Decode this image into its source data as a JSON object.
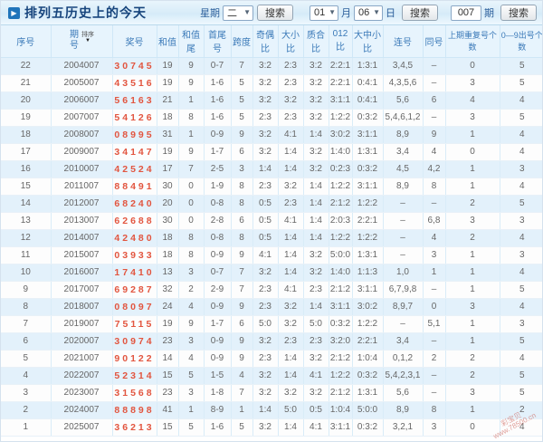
{
  "header": {
    "title": "排列五历史上的今天",
    "weekday_label": "星期",
    "weekday_value": "二",
    "month_value": "01",
    "month_label": "月",
    "day_value": "06",
    "day_label": "日",
    "issue_value": "007",
    "issue_label": "期",
    "search_label": "搜索"
  },
  "table": {
    "columns": [
      {
        "key": "xuhao",
        "label": "序号"
      },
      {
        "key": "qihao",
        "label": "期号",
        "sortable": true,
        "sort_label": "排序",
        "stack": true
      },
      {
        "key": "jianghao",
        "label": "奖号"
      },
      {
        "key": "hezhi",
        "label": "和值"
      },
      {
        "key": "hezhiwei",
        "label": "和值尾"
      },
      {
        "key": "shouweihao",
        "label": "首尾号"
      },
      {
        "key": "kuadu",
        "label": "跨度"
      },
      {
        "key": "jioubi",
        "label": "奇偶比"
      },
      {
        "key": "daxiaobi",
        "label": "大小比"
      },
      {
        "key": "zhihebi",
        "label": "质合比"
      },
      {
        "key": "bi012",
        "label": "012比"
      },
      {
        "key": "dazhongxiaobi",
        "label": "大中小比"
      },
      {
        "key": "lianhao",
        "label": "连号"
      },
      {
        "key": "tonghao",
        "label": "同号"
      },
      {
        "key": "repeat",
        "label": "上期重复号个数",
        "small": true
      },
      {
        "key": "count09",
        "label": "0—9出号个数",
        "small": true
      }
    ],
    "rows": [
      [
        "22",
        "2004007",
        "30745",
        "19",
        "9",
        "0-7",
        "7",
        "3:2",
        "2:3",
        "3:2",
        "2:2:1",
        "1:3:1",
        "3,4,5",
        "–",
        "0",
        "5"
      ],
      [
        "21",
        "2005007",
        "43516",
        "19",
        "9",
        "1-6",
        "5",
        "3:2",
        "2:3",
        "3:2",
        "2:2:1",
        "0:4:1",
        "4,3,5,6",
        "–",
        "3",
        "5"
      ],
      [
        "20",
        "2006007",
        "56163",
        "21",
        "1",
        "1-6",
        "5",
        "3:2",
        "3:2",
        "3:2",
        "3:1:1",
        "0:4:1",
        "5,6",
        "6",
        "4",
        "4"
      ],
      [
        "19",
        "2007007",
        "54126",
        "18",
        "8",
        "1-6",
        "5",
        "2:3",
        "2:3",
        "3:2",
        "1:2:2",
        "0:3:2",
        "5,4,6,1,2",
        "–",
        "3",
        "5"
      ],
      [
        "18",
        "2008007",
        "08995",
        "31",
        "1",
        "0-9",
        "9",
        "3:2",
        "4:1",
        "1:4",
        "3:0:2",
        "3:1:1",
        "8,9",
        "9",
        "1",
        "4"
      ],
      [
        "17",
        "2009007",
        "34147",
        "19",
        "9",
        "1-7",
        "6",
        "3:2",
        "1:4",
        "3:2",
        "1:4:0",
        "1:3:1",
        "3,4",
        "4",
        "0",
        "4"
      ],
      [
        "16",
        "2010007",
        "42524",
        "17",
        "7",
        "2-5",
        "3",
        "1:4",
        "1:4",
        "3:2",
        "0:2:3",
        "0:3:2",
        "4,5",
        "4,2",
        "1",
        "3"
      ],
      [
        "15",
        "2011007",
        "88491",
        "30",
        "0",
        "1-9",
        "8",
        "2:3",
        "3:2",
        "1:4",
        "1:2:2",
        "3:1:1",
        "8,9",
        "8",
        "1",
        "4"
      ],
      [
        "14",
        "2012007",
        "68240",
        "20",
        "0",
        "0-8",
        "8",
        "0:5",
        "2:3",
        "1:4",
        "2:1:2",
        "1:2:2",
        "–",
        "–",
        "2",
        "5"
      ],
      [
        "13",
        "2013007",
        "62688",
        "30",
        "0",
        "2-8",
        "6",
        "0:5",
        "4:1",
        "1:4",
        "2:0:3",
        "2:2:1",
        "–",
        "6,8",
        "3",
        "3"
      ],
      [
        "12",
        "2014007",
        "42480",
        "18",
        "8",
        "0-8",
        "8",
        "0:5",
        "1:4",
        "1:4",
        "1:2:2",
        "1:2:2",
        "–",
        "4",
        "2",
        "4"
      ],
      [
        "11",
        "2015007",
        "03933",
        "18",
        "8",
        "0-9",
        "9",
        "4:1",
        "1:4",
        "3:2",
        "5:0:0",
        "1:3:1",
        "–",
        "3",
        "1",
        "3"
      ],
      [
        "10",
        "2016007",
        "17410",
        "13",
        "3",
        "0-7",
        "7",
        "3:2",
        "1:4",
        "3:2",
        "1:4:0",
        "1:1:3",
        "1,0",
        "1",
        "1",
        "4"
      ],
      [
        "9",
        "2017007",
        "69287",
        "32",
        "2",
        "2-9",
        "7",
        "2:3",
        "4:1",
        "2:3",
        "2:1:2",
        "3:1:1",
        "6,7,9,8",
        "–",
        "1",
        "5"
      ],
      [
        "8",
        "2018007",
        "08097",
        "24",
        "4",
        "0-9",
        "9",
        "2:3",
        "3:2",
        "1:4",
        "3:1:1",
        "3:0:2",
        "8,9,7",
        "0",
        "3",
        "4"
      ],
      [
        "7",
        "2019007",
        "75115",
        "19",
        "9",
        "1-7",
        "6",
        "5:0",
        "3:2",
        "5:0",
        "0:3:2",
        "1:2:2",
        "–",
        "5,1",
        "1",
        "3"
      ],
      [
        "6",
        "2020007",
        "30974",
        "23",
        "3",
        "0-9",
        "9",
        "3:2",
        "2:3",
        "2:3",
        "3:2:0",
        "2:2:1",
        "3,4",
        "–",
        "1",
        "5"
      ],
      [
        "5",
        "2021007",
        "90122",
        "14",
        "4",
        "0-9",
        "9",
        "2:3",
        "1:4",
        "3:2",
        "2:1:2",
        "1:0:4",
        "0,1,2",
        "2",
        "2",
        "4"
      ],
      [
        "4",
        "2022007",
        "52314",
        "15",
        "5",
        "1-5",
        "4",
        "3:2",
        "1:4",
        "4:1",
        "1:2:2",
        "0:3:2",
        "5,4,2,3,1",
        "–",
        "2",
        "5"
      ],
      [
        "3",
        "2023007",
        "31568",
        "23",
        "3",
        "1-8",
        "7",
        "3:2",
        "3:2",
        "3:2",
        "2:1:2",
        "1:3:1",
        "5,6",
        "–",
        "3",
        "5"
      ],
      [
        "2",
        "2024007",
        "88898",
        "41",
        "1",
        "8-9",
        "1",
        "1:4",
        "5:0",
        "0:5",
        "1:0:4",
        "5:0:0",
        "8,9",
        "8",
        "1",
        "2"
      ],
      [
        "1",
        "2025007",
        "36213",
        "15",
        "5",
        "1-6",
        "5",
        "3:2",
        "1:4",
        "4:1",
        "3:1:1",
        "0:3:2",
        "3,2,1",
        "3",
        "0",
        "4"
      ]
    ]
  },
  "watermark": {
    "line1": "彩宝贝",
    "line2": "www.78500.cn"
  },
  "colors": {
    "title_text": "#16447c",
    "header_bg": "#e7f4fd",
    "header_text": "#3a79b8",
    "row_alt_bg": "#e3f1fb",
    "prize_red": "#e2553f"
  }
}
